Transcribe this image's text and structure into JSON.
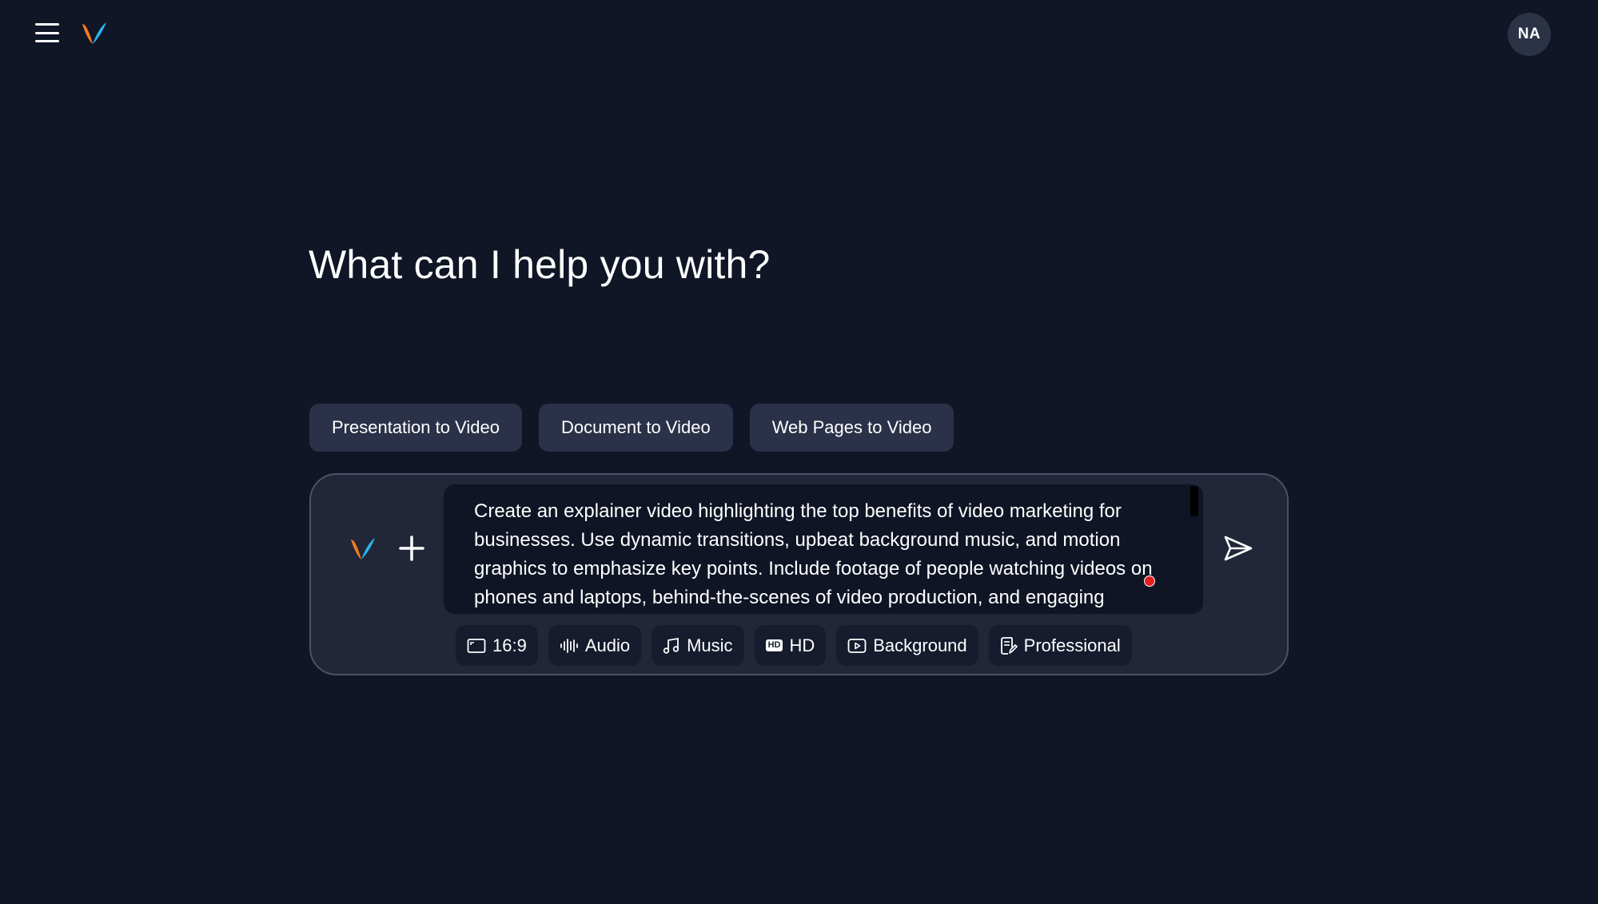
{
  "header": {
    "menu_icon": "hamburger-menu-icon",
    "logo_icon": "v-logo-icon",
    "avatar_initials": "NA"
  },
  "main": {
    "title": "What can I help you with?",
    "suggestions": [
      {
        "label": "Presentation to Video"
      },
      {
        "label": "Document to Video"
      },
      {
        "label": "Web Pages to Video"
      }
    ]
  },
  "composer": {
    "prompt_text": "Create an explainer video highlighting the top benefits of video marketing for businesses. Use dynamic transitions, upbeat background music, and motion graphics to emphasize key points. Include footage of people watching videos on phones and laptops, behind-the-scenes of video production, and engaging",
    "add_icon": "plus-icon",
    "send_icon": "send-icon",
    "options": [
      {
        "label": "16:9",
        "icon": "aspect-ratio-icon"
      },
      {
        "label": "Audio",
        "icon": "audio-waveform-icon"
      },
      {
        "label": "Music",
        "icon": "music-note-icon"
      },
      {
        "label": "HD",
        "icon": "hd-icon"
      },
      {
        "label": "Background",
        "icon": "play-box-icon"
      },
      {
        "label": "Professional",
        "icon": "document-edit-icon"
      }
    ]
  },
  "colors": {
    "background": "#101626",
    "composer_bg": "#212739",
    "chip_bg": "#2b3148",
    "logo_orange": "#f47a1f",
    "logo_blue": "#2bb6f0"
  }
}
